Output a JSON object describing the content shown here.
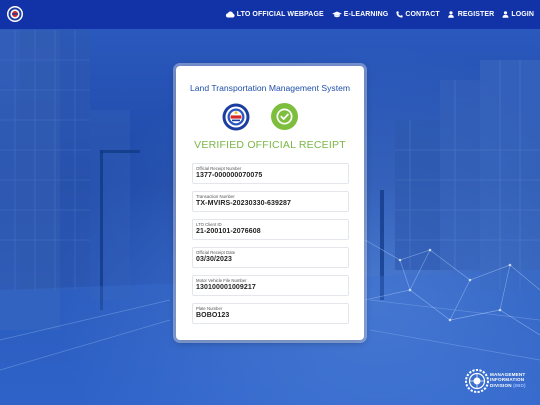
{
  "nav": {
    "items": [
      {
        "label": "LTO OFFICIAL WEBPAGE",
        "icon": "cloud-icon"
      },
      {
        "label": "E-LEARNING",
        "icon": "graduation-cap-icon"
      },
      {
        "label": "CONTACT",
        "icon": "phone-icon"
      },
      {
        "label": "REGISTER",
        "icon": "user-plus-icon"
      },
      {
        "label": "LOGIN",
        "icon": "user-icon"
      }
    ]
  },
  "card": {
    "title": "Land Transportation Management System",
    "status": "VERIFIED OFFICIAL RECEIPT",
    "fields": [
      {
        "label": "Official Receipt Number",
        "value": "1377-000000070075"
      },
      {
        "label": "Transaction Number",
        "value": "TX-MVIRS-20230330-639287"
      },
      {
        "label": "LTO Client ID",
        "value": "21-200101-2076608"
      },
      {
        "label": "Official Receipt Date",
        "value": "03/30/2023"
      },
      {
        "label": "Motor Vehicle File Number",
        "value": "130100001009217"
      },
      {
        "label": "Plate Number",
        "value": "BOBO123"
      }
    ]
  },
  "footer_logo": {
    "line1": "MANAGEMENT",
    "line2": "INFORMATION",
    "line3": "DIVISION",
    "line3_suffix": "(MID)"
  },
  "colors": {
    "topbar": "#1233a8",
    "title": "#1f4fa8",
    "verified": "#7ab648",
    "check": "#7dbf3c"
  }
}
